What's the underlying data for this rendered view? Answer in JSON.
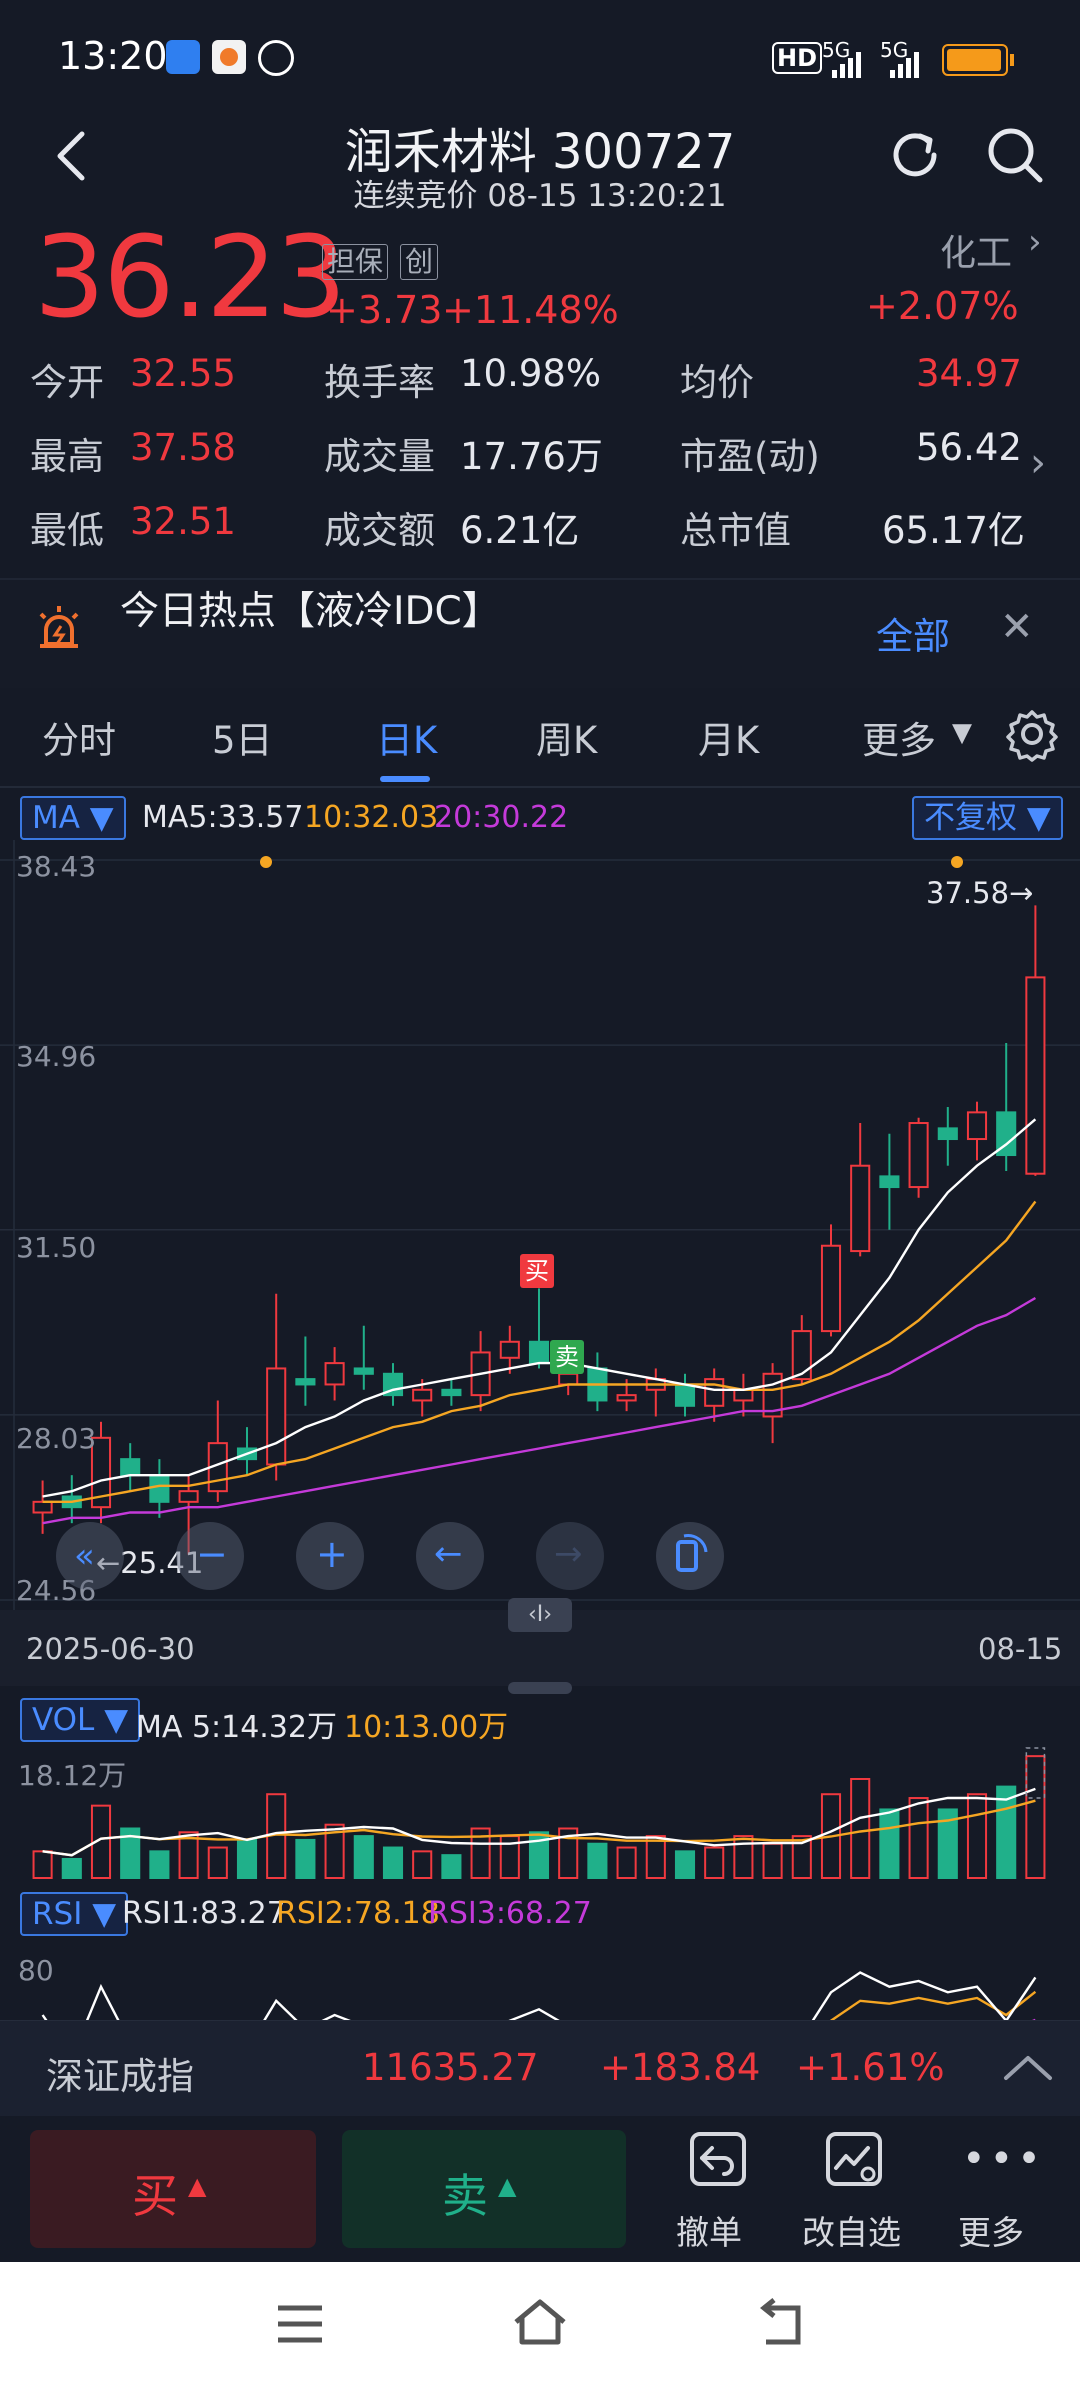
{
  "status_bar": {
    "time": "13:20",
    "signal_left": "5G",
    "signal_right": "5G",
    "hd": "HD"
  },
  "header": {
    "title": "润禾材料 300727",
    "subtitle": "连续竞价 08-15 13:20:21"
  },
  "quote": {
    "price": "36.23",
    "tags": [
      "担保",
      "创"
    ],
    "change_abs": "+3.73",
    "change_pct": "+11.48%",
    "sector_name": "化工",
    "sector_change": "+2.07%",
    "rows": [
      [
        {
          "label": "今开",
          "value": "32.55",
          "color": "#f0393f"
        },
        {
          "label": "换手率",
          "value": "10.98%",
          "color": "#e6e8ee"
        },
        {
          "label": "均价",
          "value": "34.97",
          "color": "#f0393f"
        }
      ],
      [
        {
          "label": "最高",
          "value": "37.58",
          "color": "#f0393f"
        },
        {
          "label": "成交量",
          "value": "17.76万",
          "color": "#e6e8ee"
        },
        {
          "label": "市盈(动)",
          "value": "56.42",
          "color": "#e6e8ee"
        }
      ],
      [
        {
          "label": "最低",
          "value": "32.51",
          "color": "#f0393f"
        },
        {
          "label": "成交额",
          "value": "6.21亿",
          "color": "#e6e8ee"
        },
        {
          "label": "总市值",
          "value": "65.17亿",
          "color": "#e6e8ee"
        }
      ]
    ]
  },
  "hot_topic": {
    "text": "今日热点【液冷IDC】",
    "all_label": "全部"
  },
  "tabs": [
    "分时",
    "5日",
    "日K",
    "周K",
    "月K",
    "更多"
  ],
  "active_tab": "日K",
  "indicators": {
    "ma_label": "MA",
    "ma5": "MA5:33.57",
    "ma10": "10:32.03",
    "ma20": "20:30.22",
    "adjust": "不复权",
    "vol_label": "VOL",
    "vol_ma5": "MA 5:14.32万",
    "vol_ma10": "10:13.00万",
    "vol_max": "18.12万",
    "rsi_label": "RSI",
    "rsi1": "RSI1:83.27",
    "rsi2": "RSI2:78.18",
    "rsi3": "RSI3:68.27",
    "rsi_tick": "80"
  },
  "chart_labels": {
    "high_marker": "37.58→",
    "low_marker": "←25.41",
    "buy_mark": "买",
    "sell_mark": "卖",
    "date_start": "2025-06-30",
    "date_end": "08-15",
    "scroll_handle": "‹I›"
  },
  "colors": {
    "up": "#f0393f",
    "down": "#20b08a",
    "ma5": "#ffffff",
    "ma10": "#f5a623",
    "ma20": "#c43ad9",
    "accent": "#4a8cff"
  },
  "chart_data": {
    "type": "candlestick",
    "ylim": [
      24.56,
      38.43
    ],
    "y_ticks": [
      "38.43",
      "34.96",
      "31.50",
      "28.03",
      "24.56"
    ],
    "candles": [
      {
        "o": 26.2,
        "c": 26.4,
        "h": 26.8,
        "l": 25.8
      },
      {
        "o": 26.5,
        "c": 26.3,
        "h": 26.9,
        "l": 26.0
      },
      {
        "o": 26.3,
        "c": 27.6,
        "h": 27.9,
        "l": 26.0
      },
      {
        "o": 27.2,
        "c": 26.9,
        "h": 27.5,
        "l": 26.6
      },
      {
        "o": 26.9,
        "c": 26.4,
        "h": 27.2,
        "l": 26.1
      },
      {
        "o": 26.4,
        "c": 26.6,
        "h": 26.9,
        "l": 25.41
      },
      {
        "o": 26.6,
        "c": 27.5,
        "h": 28.3,
        "l": 26.4
      },
      {
        "o": 27.4,
        "c": 27.2,
        "h": 27.8,
        "l": 26.9
      },
      {
        "o": 27.1,
        "c": 28.9,
        "h": 30.3,
        "l": 26.8
      },
      {
        "o": 28.7,
        "c": 28.6,
        "h": 29.5,
        "l": 28.2
      },
      {
        "o": 28.6,
        "c": 29.0,
        "h": 29.3,
        "l": 28.3
      },
      {
        "o": 28.9,
        "c": 28.8,
        "h": 29.7,
        "l": 28.5
      },
      {
        "o": 28.8,
        "c": 28.4,
        "h": 29.0,
        "l": 28.2
      },
      {
        "o": 28.3,
        "c": 28.5,
        "h": 28.7,
        "l": 28.0
      },
      {
        "o": 28.5,
        "c": 28.4,
        "h": 28.7,
        "l": 28.2
      },
      {
        "o": 28.4,
        "c": 29.2,
        "h": 29.6,
        "l": 28.1
      },
      {
        "o": 29.1,
        "c": 29.4,
        "h": 29.7,
        "l": 28.8
      },
      {
        "o": 29.4,
        "c": 29.0,
        "h": 30.4,
        "l": 28.9
      },
      {
        "o": 28.6,
        "c": 28.8,
        "h": 29.3,
        "l": 28.4
      },
      {
        "o": 28.9,
        "c": 28.3,
        "h": 29.2,
        "l": 28.1
      },
      {
        "o": 28.3,
        "c": 28.4,
        "h": 28.7,
        "l": 28.1
      },
      {
        "o": 28.5,
        "c": 28.7,
        "h": 28.9,
        "l": 28.0
      },
      {
        "o": 28.6,
        "c": 28.2,
        "h": 28.8,
        "l": 28.0
      },
      {
        "o": 28.2,
        "c": 28.7,
        "h": 28.9,
        "l": 27.9
      },
      {
        "o": 28.3,
        "c": 28.5,
        "h": 28.8,
        "l": 28.0
      },
      {
        "o": 28.0,
        "c": 28.8,
        "h": 29.0,
        "l": 27.5
      },
      {
        "o": 28.7,
        "c": 29.6,
        "h": 29.9,
        "l": 28.6
      },
      {
        "o": 29.6,
        "c": 31.2,
        "h": 31.6,
        "l": 29.5
      },
      {
        "o": 31.1,
        "c": 32.7,
        "h": 33.5,
        "l": 31.0
      },
      {
        "o": 32.5,
        "c": 32.3,
        "h": 33.3,
        "l": 31.5
      },
      {
        "o": 32.3,
        "c": 33.5,
        "h": 33.6,
        "l": 32.1
      },
      {
        "o": 33.4,
        "c": 33.2,
        "h": 33.8,
        "l": 32.7
      },
      {
        "o": 33.2,
        "c": 33.7,
        "h": 33.9,
        "l": 32.8
      },
      {
        "o": 33.7,
        "c": 32.9,
        "h": 35.0,
        "l": 32.6
      },
      {
        "o": 32.55,
        "c": 36.23,
        "h": 37.58,
        "l": 32.51
      }
    ],
    "ma5": [
      26.5,
      26.6,
      26.8,
      26.9,
      26.9,
      26.9,
      27.1,
      27.3,
      27.5,
      27.8,
      28.0,
      28.3,
      28.5,
      28.6,
      28.7,
      28.8,
      28.9,
      29.0,
      29.0,
      28.9,
      28.8,
      28.7,
      28.6,
      28.5,
      28.5,
      28.6,
      28.8,
      29.2,
      29.9,
      30.6,
      31.5,
      32.2,
      32.7,
      33.1,
      33.57
    ],
    "ma10": [
      26.4,
      26.4,
      26.5,
      26.6,
      26.7,
      26.7,
      26.8,
      26.9,
      27.1,
      27.2,
      27.4,
      27.6,
      27.8,
      27.9,
      28.1,
      28.2,
      28.4,
      28.5,
      28.6,
      28.6,
      28.6,
      28.6,
      28.6,
      28.6,
      28.5,
      28.5,
      28.6,
      28.8,
      29.1,
      29.4,
      29.8,
      30.3,
      30.8,
      31.3,
      32.03
    ],
    "ma20": [
      26.0,
      26.1,
      26.1,
      26.2,
      26.2,
      26.3,
      26.3,
      26.4,
      26.5,
      26.6,
      26.7,
      26.8,
      26.9,
      27.0,
      27.1,
      27.2,
      27.3,
      27.4,
      27.5,
      27.6,
      27.7,
      27.8,
      27.9,
      28.0,
      28.1,
      28.1,
      28.2,
      28.4,
      28.6,
      28.8,
      29.1,
      29.4,
      29.7,
      29.9,
      30.22
    ],
    "volume_ylim": [
      0,
      18.12
    ],
    "volumes": [
      3.5,
      2.5,
      9.5,
      6.5,
      3.5,
      6.0,
      4.0,
      5.0,
      11.0,
      5.0,
      7.0,
      5.5,
      4.0,
      3.5,
      3.0,
      6.5,
      5.5,
      6.0,
      6.5,
      4.5,
      4.0,
      5.5,
      3.5,
      4.0,
      5.5,
      4.5,
      5.5,
      11.0,
      13.0,
      9.0,
      10.5,
      9.0,
      11.0,
      12.0,
      16.0
    ],
    "rsi1": [
      70,
      55,
      80,
      60,
      50,
      45,
      62,
      58,
      75,
      65,
      70,
      66,
      60,
      55,
      52,
      63,
      68,
      72,
      66,
      55,
      52,
      54,
      48,
      53,
      50,
      52,
      62,
      78,
      85,
      80,
      82,
      78,
      80,
      68,
      83.27
    ],
    "rsi2": [
      60,
      56,
      65,
      60,
      55,
      52,
      57,
      56,
      64,
      62,
      64,
      63,
      60,
      57,
      55,
      58,
      61,
      64,
      62,
      57,
      55,
      55,
      52,
      53,
      52,
      53,
      58,
      68,
      75,
      74,
      76,
      74,
      76,
      70,
      78.18
    ],
    "rsi3": [
      52,
      51,
      55,
      53,
      52,
      50,
      52,
      52,
      55,
      55,
      56,
      56,
      55,
      54,
      53,
      54,
      55,
      56,
      56,
      54,
      53,
      53,
      52,
      52,
      52,
      52,
      54,
      58,
      62,
      63,
      65,
      65,
      66,
      64,
      68.27
    ],
    "rsi_ylim": [
      40,
      100
    ]
  },
  "index_bar": {
    "name": "深证成指",
    "value": "11635.27",
    "change": "+183.84",
    "pct": "+1.61%"
  },
  "trade_bar": {
    "buy": "买",
    "sell": "卖",
    "cancel": "撤单",
    "watchlist": "改自选",
    "more": "更多"
  }
}
